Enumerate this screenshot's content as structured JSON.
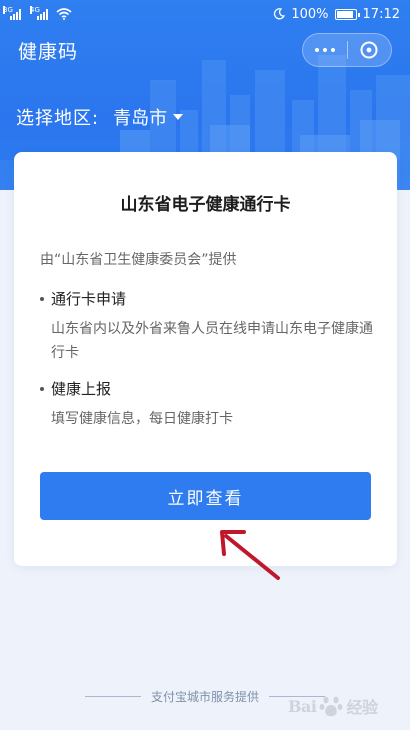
{
  "status_bar": {
    "net1": "3G",
    "net2": "4G",
    "battery": "100%",
    "time": "17:12"
  },
  "nav": {
    "title": "健康码"
  },
  "region": {
    "label": "选择地区:",
    "value": "青岛市"
  },
  "card": {
    "title": "山东省电子健康通行卡",
    "provider": "由“山东省卫生健康委员会”提供",
    "features": [
      {
        "title": "通行卡申请",
        "desc": "山东省内以及外省来鲁人员在线申请山东电子健康通行卡"
      },
      {
        "title": "健康上报",
        "desc": "填写健康信息，每日健康打卡"
      }
    ],
    "button_label": "立即查看"
  },
  "footer": {
    "text": "支付宝城市服务提供"
  },
  "watermark": {
    "left": "Bai",
    "right": "经验"
  },
  "colors": {
    "primary": "#2f7bf0",
    "header": "#2b76ee",
    "arrow": "#c0182a"
  },
  "icons": {
    "more": "more-dots-icon",
    "close": "close-mini-program-icon",
    "caret": "caret-down-icon"
  }
}
